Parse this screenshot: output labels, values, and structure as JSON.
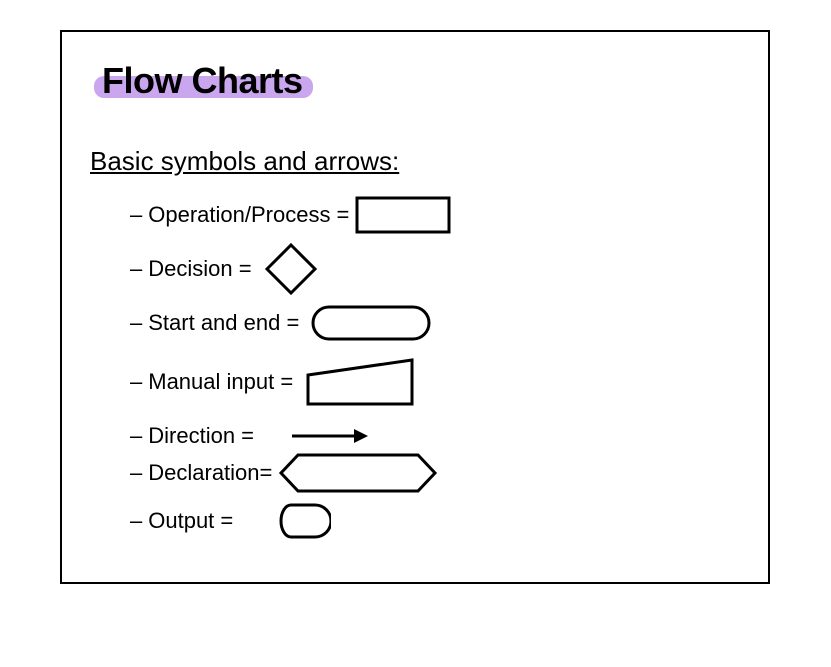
{
  "title": "Flow Charts",
  "subtitle": "Basic symbols and arrows:",
  "items": [
    {
      "label": "Operation/Process =",
      "symbol": "rectangle"
    },
    {
      "label": "Decision = ",
      "symbol": "diamond"
    },
    {
      "label": "Start and end = ",
      "symbol": "terminator"
    },
    {
      "label": "Manual input = ",
      "symbol": "manual-input"
    },
    {
      "label": "Direction = ",
      "symbol": "arrow"
    },
    {
      "label": "Declaration=",
      "symbol": "hexagon"
    },
    {
      "label": "Output = ",
      "symbol": "display"
    }
  ],
  "colors": {
    "highlight": "#caa6ef",
    "stroke": "#000000"
  }
}
